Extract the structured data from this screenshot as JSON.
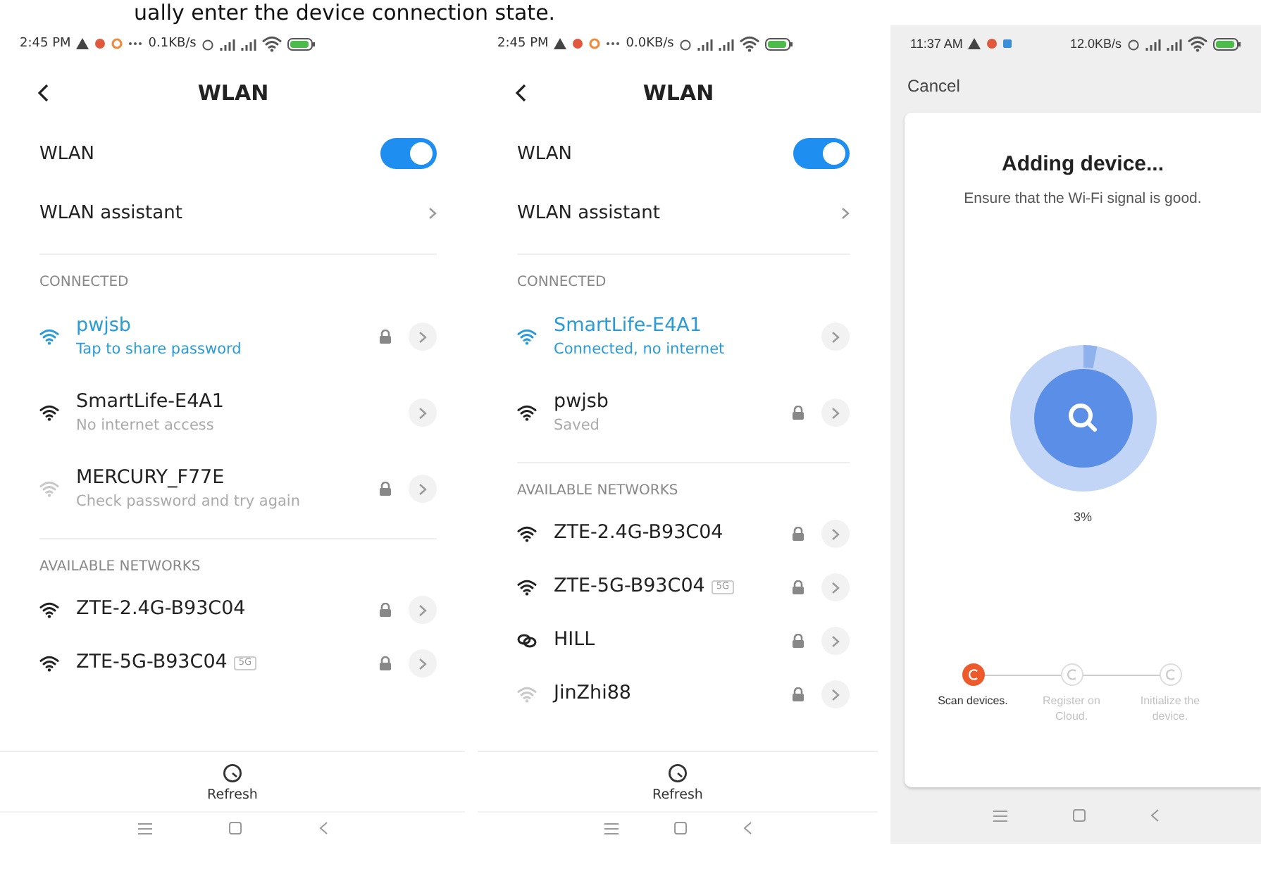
{
  "caption": "ually enter the device connection state.",
  "screens": [
    {
      "kind": "wlan",
      "status_bar": {
        "time": "2:45 PM",
        "speed": "0.1KB/s"
      },
      "title": "WLAN",
      "wlan": {
        "label": "WLAN",
        "on": true
      },
      "assistant": "WLAN assistant",
      "sections": [
        {
          "heading": "CONNECTED",
          "networks": [
            {
              "kind": "wifi",
              "name": "pwjsb",
              "subtitle": "Tap to share password",
              "connected": true,
              "weak": false,
              "locked": true
            },
            {
              "kind": "wifi",
              "name": "SmartLife-E4A1",
              "subtitle": "No internet access",
              "connected": false,
              "weak": false,
              "locked": false
            },
            {
              "kind": "wifi",
              "name": "MERCURY_F77E",
              "subtitle": "Check password and try again",
              "connected": false,
              "weak": true,
              "locked": true
            }
          ]
        },
        {
          "heading": "AVAILABLE NETWORKS",
          "networks": [
            {
              "kind": "wifi",
              "name": "ZTE-2.4G-B93C04",
              "connected": false,
              "weak": false,
              "locked": true
            },
            {
              "kind": "wifi",
              "name": "ZTE-5G-B93C04",
              "band": "5G",
              "connected": false,
              "weak": false,
              "locked": true
            }
          ]
        }
      ],
      "refresh": "Refresh"
    },
    {
      "kind": "wlan",
      "status_bar": {
        "time": "2:45 PM",
        "speed": "0.0KB/s"
      },
      "title": "WLAN",
      "wlan": {
        "label": "WLAN",
        "on": true
      },
      "assistant": "WLAN assistant",
      "sections": [
        {
          "heading": "CONNECTED",
          "networks": [
            {
              "kind": "wifi",
              "name": "SmartLife-E4A1",
              "subtitle": "Connected, no internet",
              "connected": true,
              "weak": false,
              "locked": false
            },
            {
              "kind": "wifi",
              "name": "pwjsb",
              "subtitle": "Saved",
              "connected": false,
              "weak": false,
              "locked": true
            }
          ]
        },
        {
          "heading": "AVAILABLE NETWORKS",
          "networks": [
            {
              "kind": "wifi",
              "name": "ZTE-2.4G-B93C04",
              "connected": false,
              "weak": false,
              "locked": true
            },
            {
              "kind": "wifi",
              "name": "ZTE-5G-B93C04",
              "band": "5G",
              "connected": false,
              "weak": false,
              "locked": true
            },
            {
              "kind": "hotspot",
              "name": "HILL",
              "connected": false,
              "weak": false,
              "locked": true
            },
            {
              "kind": "wifi",
              "name": "JinZhi88",
              "connected": false,
              "weak": true,
              "locked": true
            }
          ]
        }
      ],
      "refresh": "Refresh"
    },
    {
      "kind": "progress",
      "status_bar": {
        "time": "11:37 AM",
        "speed": "12.0KB/s"
      },
      "cancel": "Cancel",
      "title": "Adding device...",
      "subtitle": "Ensure that the Wi-Fi signal is good.",
      "progress": {
        "level": 0.03,
        "reading": "3%"
      },
      "steps": [
        {
          "label": "Scan devices.",
          "active": true
        },
        {
          "label": "Register on Cloud.",
          "active": false
        },
        {
          "label": "Initialize the device.",
          "active": false
        }
      ]
    }
  ]
}
